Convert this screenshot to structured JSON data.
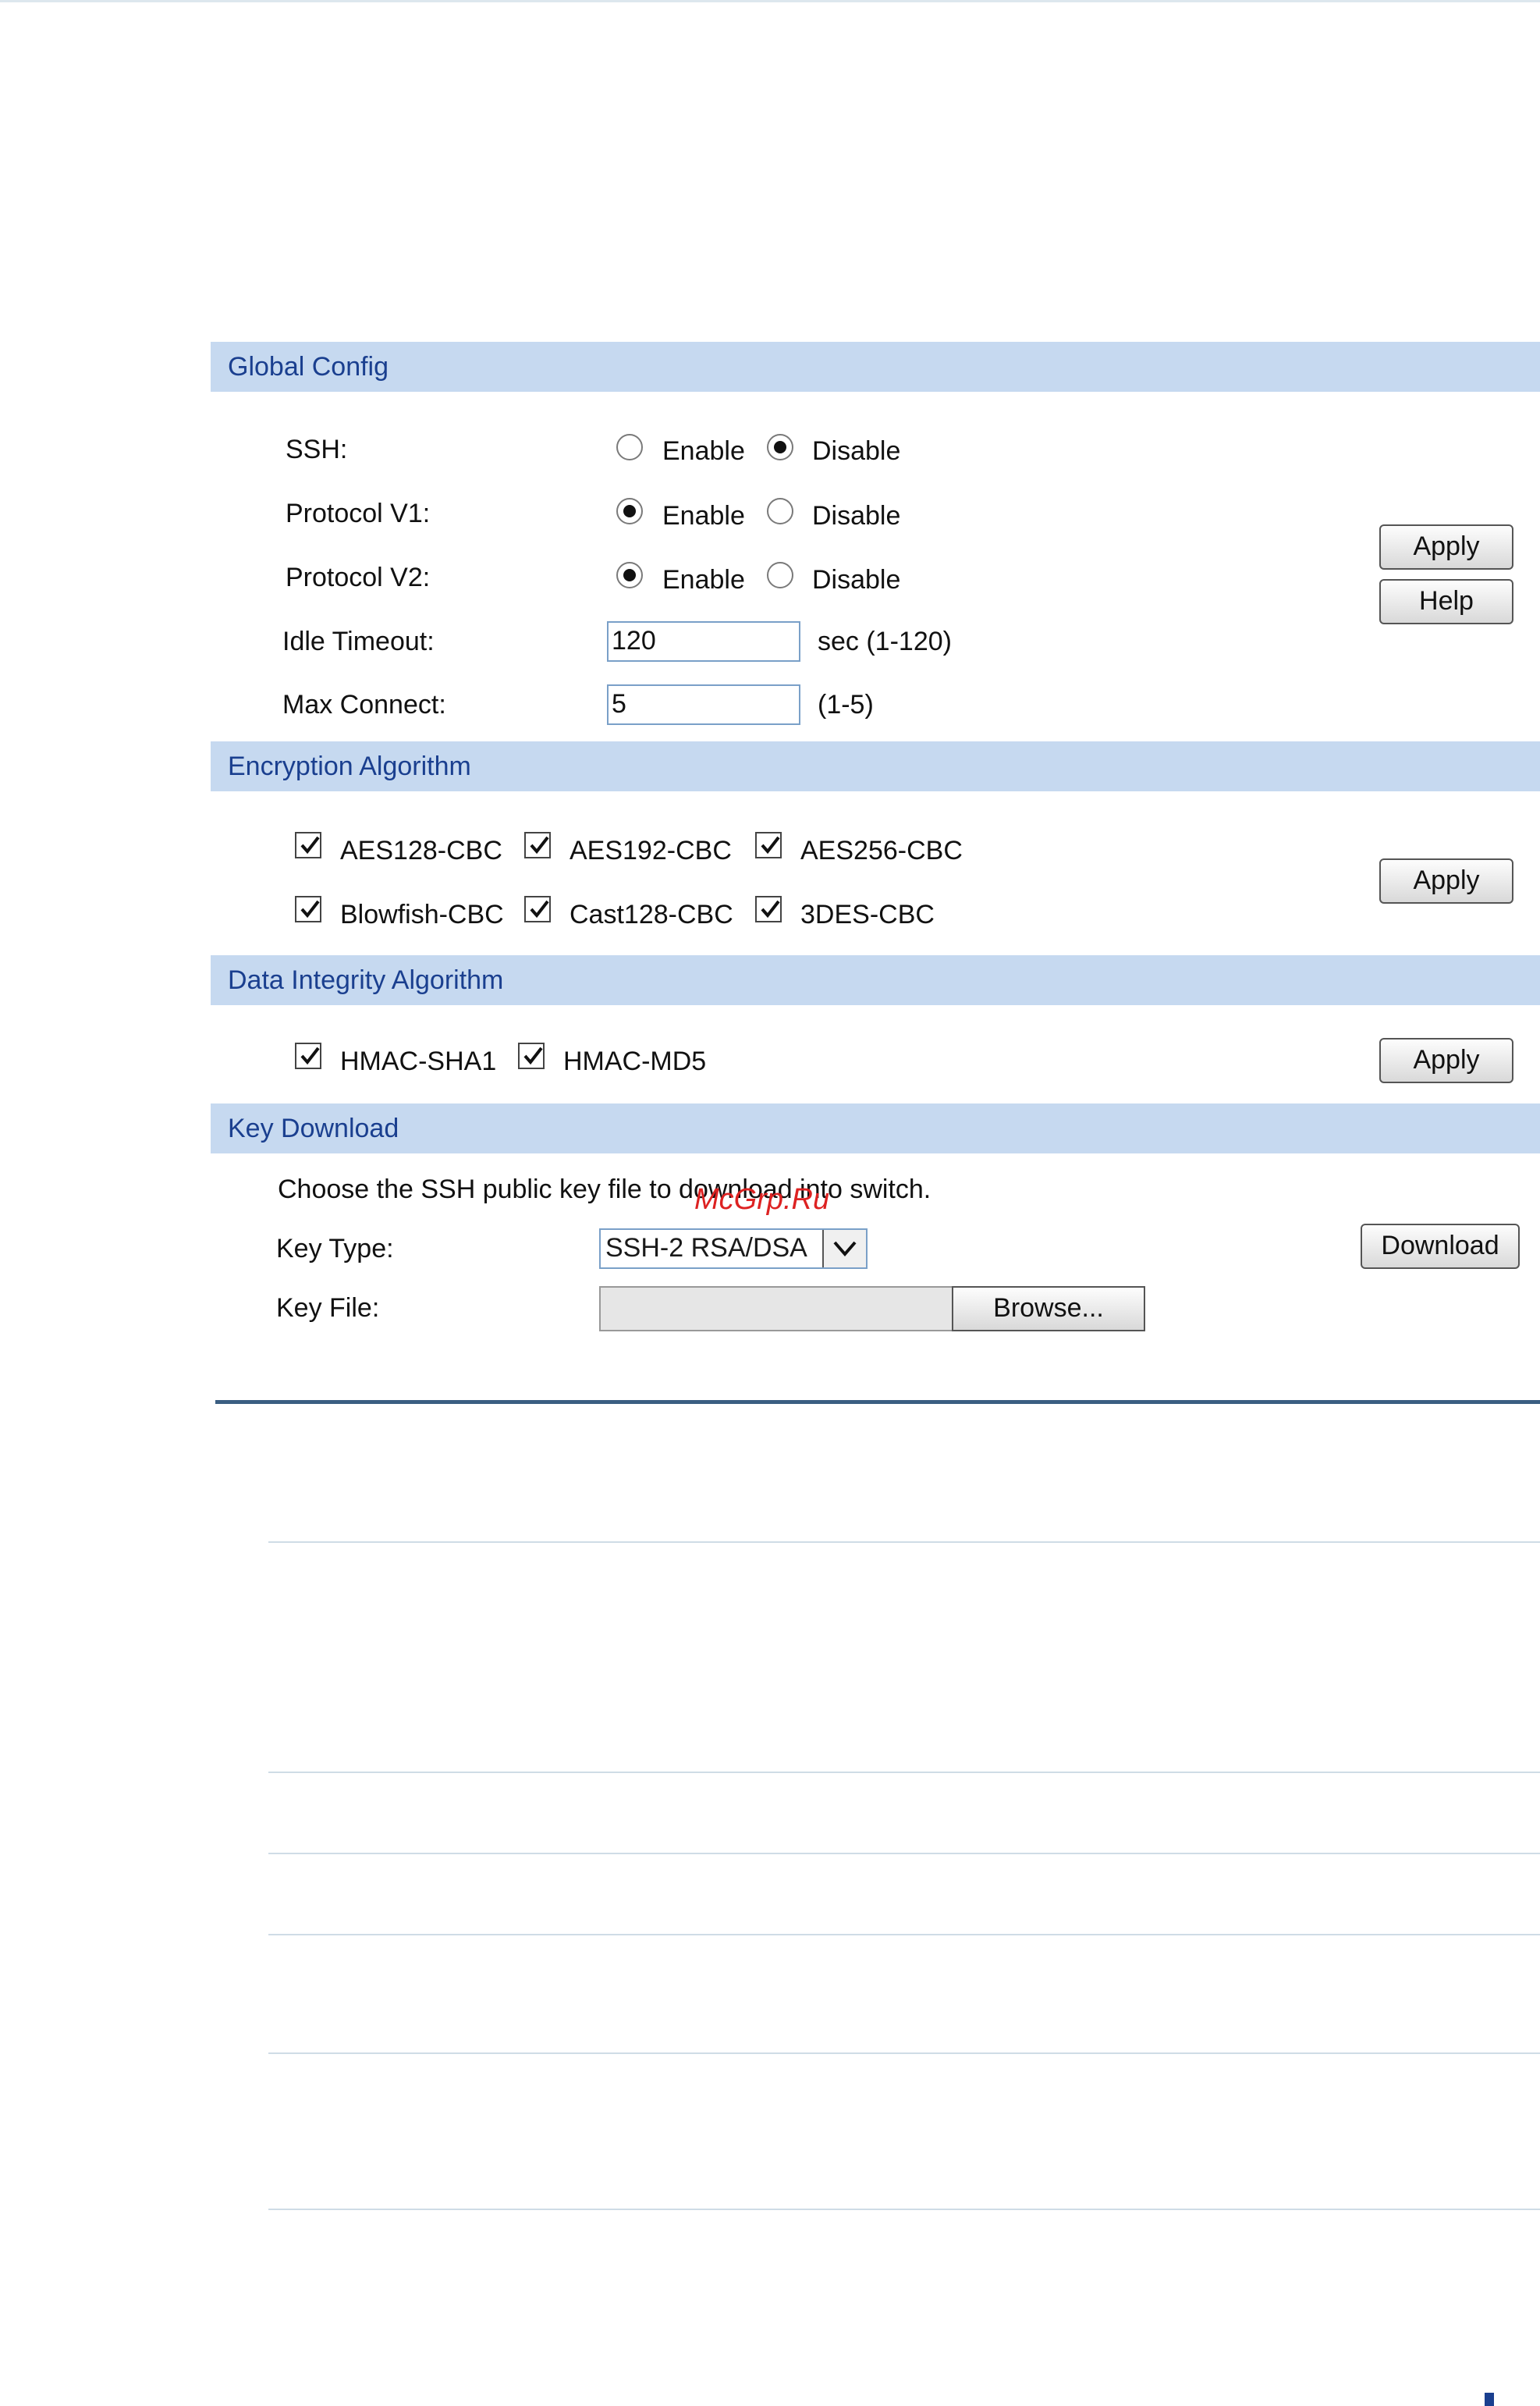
{
  "global_config": {
    "title": "Global Config",
    "ssh": {
      "label": "SSH:",
      "selected": "Disable"
    },
    "protocol_v1": {
      "label": "Protocol V1:",
      "selected": "Enable"
    },
    "protocol_v2": {
      "label": "Protocol V2:",
      "selected": "Enable"
    },
    "enable_label": "Enable",
    "disable_label": "Disable",
    "idle_timeout": {
      "label": "Idle Timeout:",
      "value": "120",
      "hint": "sec (1-120)"
    },
    "max_connect": {
      "label": "Max Connect:",
      "value": "5",
      "hint": "(1-5)"
    },
    "apply_label": "Apply",
    "help_label": "Help"
  },
  "encryption": {
    "title": "Encryption Algorithm",
    "options": [
      {
        "label": "AES128-CBC",
        "checked": true
      },
      {
        "label": "AES192-CBC",
        "checked": true
      },
      {
        "label": "AES256-CBC",
        "checked": true
      },
      {
        "label": "Blowfish-CBC",
        "checked": true
      },
      {
        "label": "Cast128-CBC",
        "checked": true
      },
      {
        "label": "3DES-CBC",
        "checked": true
      }
    ],
    "apply_label": "Apply"
  },
  "integrity": {
    "title": "Data Integrity Algorithm",
    "options": [
      {
        "label": "HMAC-SHA1",
        "checked": true
      },
      {
        "label": "HMAC-MD5",
        "checked": true
      }
    ],
    "apply_label": "Apply"
  },
  "key_download": {
    "title": "Key Download",
    "description": "Choose the SSH public key file to download into switch.",
    "key_type": {
      "label": "Key Type:",
      "value": "SSH-2 RSA/DSA"
    },
    "key_file": {
      "label": "Key File:",
      "browse_label": "Browse..."
    },
    "download_label": "Download"
  },
  "watermark": "McGrp.Ru"
}
